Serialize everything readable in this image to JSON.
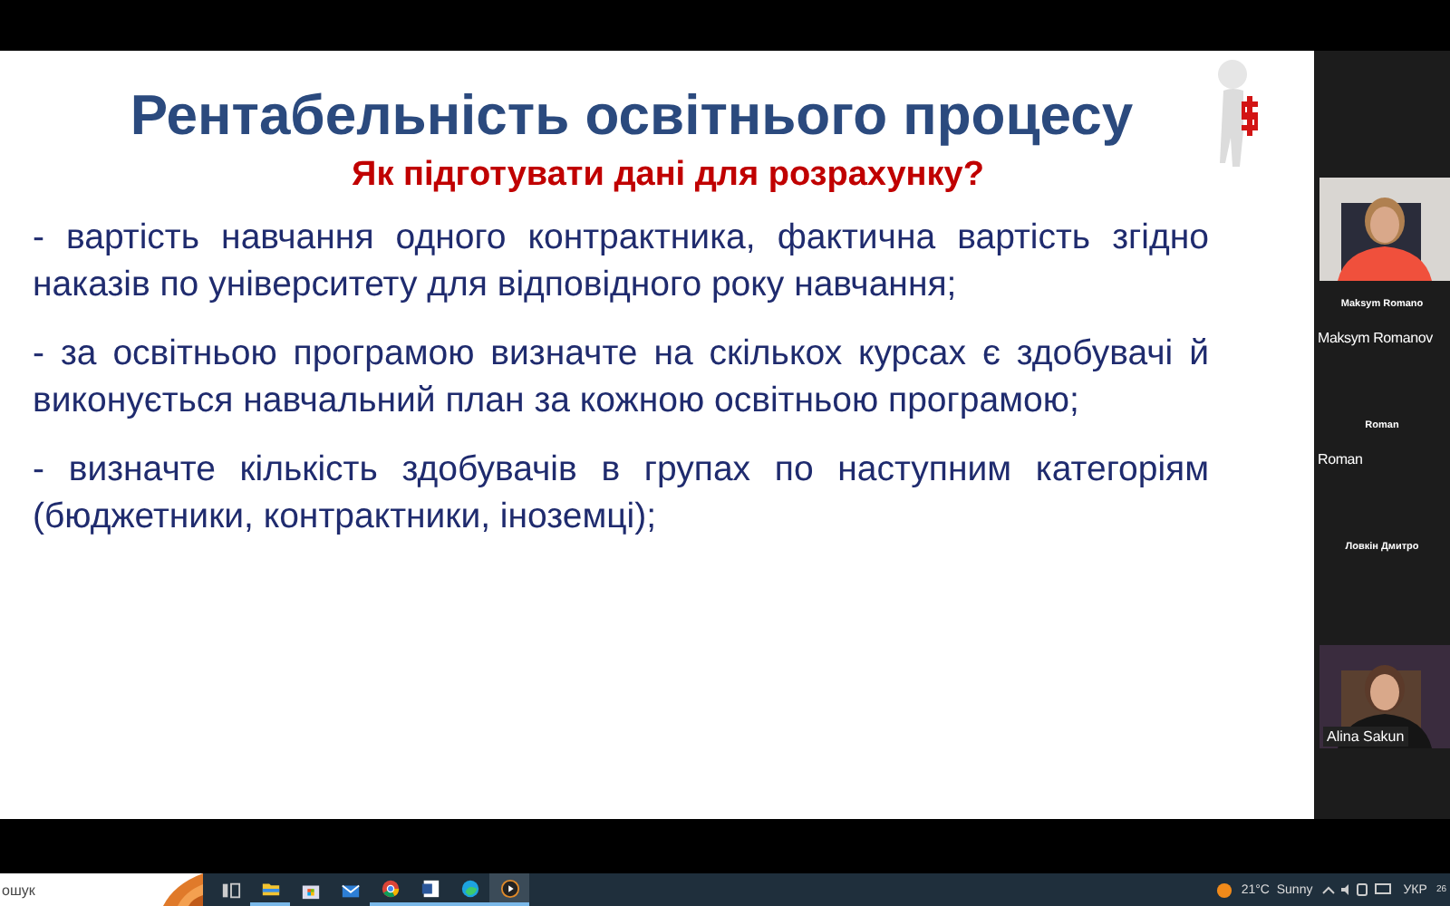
{
  "slide": {
    "title": "Рентабельність освітнього процесу",
    "subtitle": "Як підготувати дані для розрахунку?",
    "bullets": [
      "-   вартість навчання одного контрактника, фактична вартість згідно наказів по університету для відповідного року навчання;",
      "-  за освітньою програмою визначте на скількох курсах є здобувачі й виконується навчальний план за кожною освітньою програмою;",
      "-   визначте кількість здобувачів в групах по наступним категоріям (бюджетники, контрактники, іноземці);"
    ]
  },
  "participants": [
    {
      "kind": "video"
    },
    {
      "kind": "name",
      "heading": "Maksym Romano",
      "label": "Maksym Romanov"
    },
    {
      "kind": "name",
      "heading": "Roman",
      "label": "Roman"
    },
    {
      "kind": "name",
      "heading": "Ловкін Дмитро"
    },
    {
      "kind": "video",
      "label": "Alina Sakun"
    }
  ],
  "taskbar": {
    "search": {
      "placeholder": "ошук"
    },
    "apps": [
      {
        "kind": "taskview",
        "selected": false
      },
      {
        "kind": "folder",
        "selected": true
      },
      {
        "kind": "store",
        "selected": false
      },
      {
        "kind": "mail",
        "selected": false
      },
      {
        "kind": "chrome",
        "selected": true
      },
      {
        "kind": "word",
        "selected": true
      },
      {
        "kind": "edge",
        "selected": true
      },
      {
        "kind": "player",
        "selected": true
      }
    ],
    "weather": "21°C  Sunny",
    "tray": {
      "language": "УКР",
      "clock": "26"
    }
  }
}
